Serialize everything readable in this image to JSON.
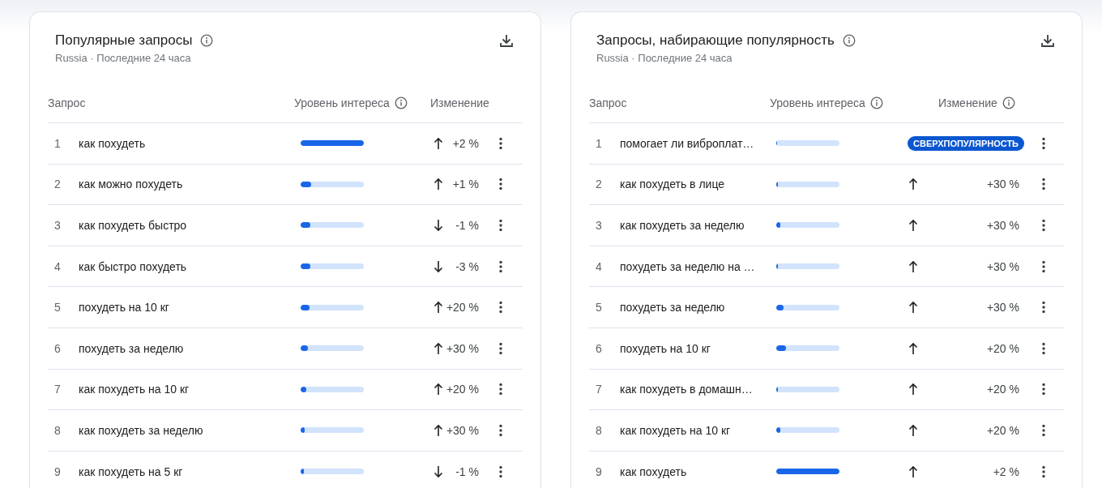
{
  "cards": [
    {
      "title": "Популярные запросы",
      "subtitle": "Russia · Последние 24 часа",
      "columns": [
        "Запрос",
        "Уровень интереса",
        "Изменение"
      ],
      "rows": [
        {
          "rank": "1",
          "query": "как похудеть",
          "level": 1.0,
          "kind": "change",
          "rising": true,
          "change": "+2 %"
        },
        {
          "rank": "2",
          "query": "как можно похудеть",
          "level": 0.17,
          "kind": "change",
          "rising": true,
          "change": "+1 %"
        },
        {
          "rank": "3",
          "query": "как похудеть быстро",
          "level": 0.15,
          "kind": "change",
          "rising": false,
          "change": "-1 %"
        },
        {
          "rank": "4",
          "query": "как быстро похудеть",
          "level": 0.15,
          "kind": "change",
          "rising": false,
          "change": "-3 %"
        },
        {
          "rank": "5",
          "query": "похудеть на 10 кг",
          "level": 0.14,
          "kind": "change",
          "rising": true,
          "change": "+20 %"
        },
        {
          "rank": "6",
          "query": "похудеть за неделю",
          "level": 0.11,
          "kind": "change",
          "rising": true,
          "change": "+30 %"
        },
        {
          "rank": "7",
          "query": "как похудеть на 10 кг",
          "level": 0.09,
          "kind": "change",
          "rising": true,
          "change": "+20 %"
        },
        {
          "rank": "8",
          "query": "как похудеть за неделю",
          "level": 0.07,
          "kind": "change",
          "rising": true,
          "change": "+30 %"
        },
        {
          "rank": "9",
          "query": "как похудеть на 5 кг",
          "level": 0.05,
          "kind": "change",
          "rising": false,
          "change": "-1 %"
        }
      ]
    },
    {
      "title": "Запросы, набирающие популярность",
      "subtitle": "Russia · Последние 24 часа",
      "columns": [
        "Запрос",
        "Уровень интереса",
        "Изменение"
      ],
      "rows": [
        {
          "rank": "1",
          "query": "помогает ли виброплат…",
          "level": 0.01,
          "kind": "badge",
          "badge": "СВЕРХПОПУЛЯРНОСТЬ"
        },
        {
          "rank": "2",
          "query": "как похудеть в лице",
          "level": 0.02,
          "kind": "change",
          "rising": true,
          "change": "+30 %"
        },
        {
          "rank": "3",
          "query": "как похудеть за неделю",
          "level": 0.07,
          "kind": "change",
          "rising": true,
          "change": "+30 %"
        },
        {
          "rank": "4",
          "query": "похудеть за неделю на …",
          "level": 0.02,
          "kind": "change",
          "rising": true,
          "change": "+30 %"
        },
        {
          "rank": "5",
          "query": "похудеть за неделю",
          "level": 0.11,
          "kind": "change",
          "rising": true,
          "change": "+30 %"
        },
        {
          "rank": "6",
          "query": "похудеть на 10 кг",
          "level": 0.15,
          "kind": "change",
          "rising": true,
          "change": "+20 %"
        },
        {
          "rank": "7",
          "query": "как похудеть в домашн…",
          "level": 0.03,
          "kind": "change",
          "rising": true,
          "change": "+20 %"
        },
        {
          "rank": "8",
          "query": "как похудеть на 10 кг",
          "level": 0.07,
          "kind": "change",
          "rising": true,
          "change": "+20 %"
        },
        {
          "rank": "9",
          "query": "как похудеть",
          "level": 1.0,
          "kind": "change",
          "rising": true,
          "change": "+2 %"
        }
      ]
    }
  ]
}
